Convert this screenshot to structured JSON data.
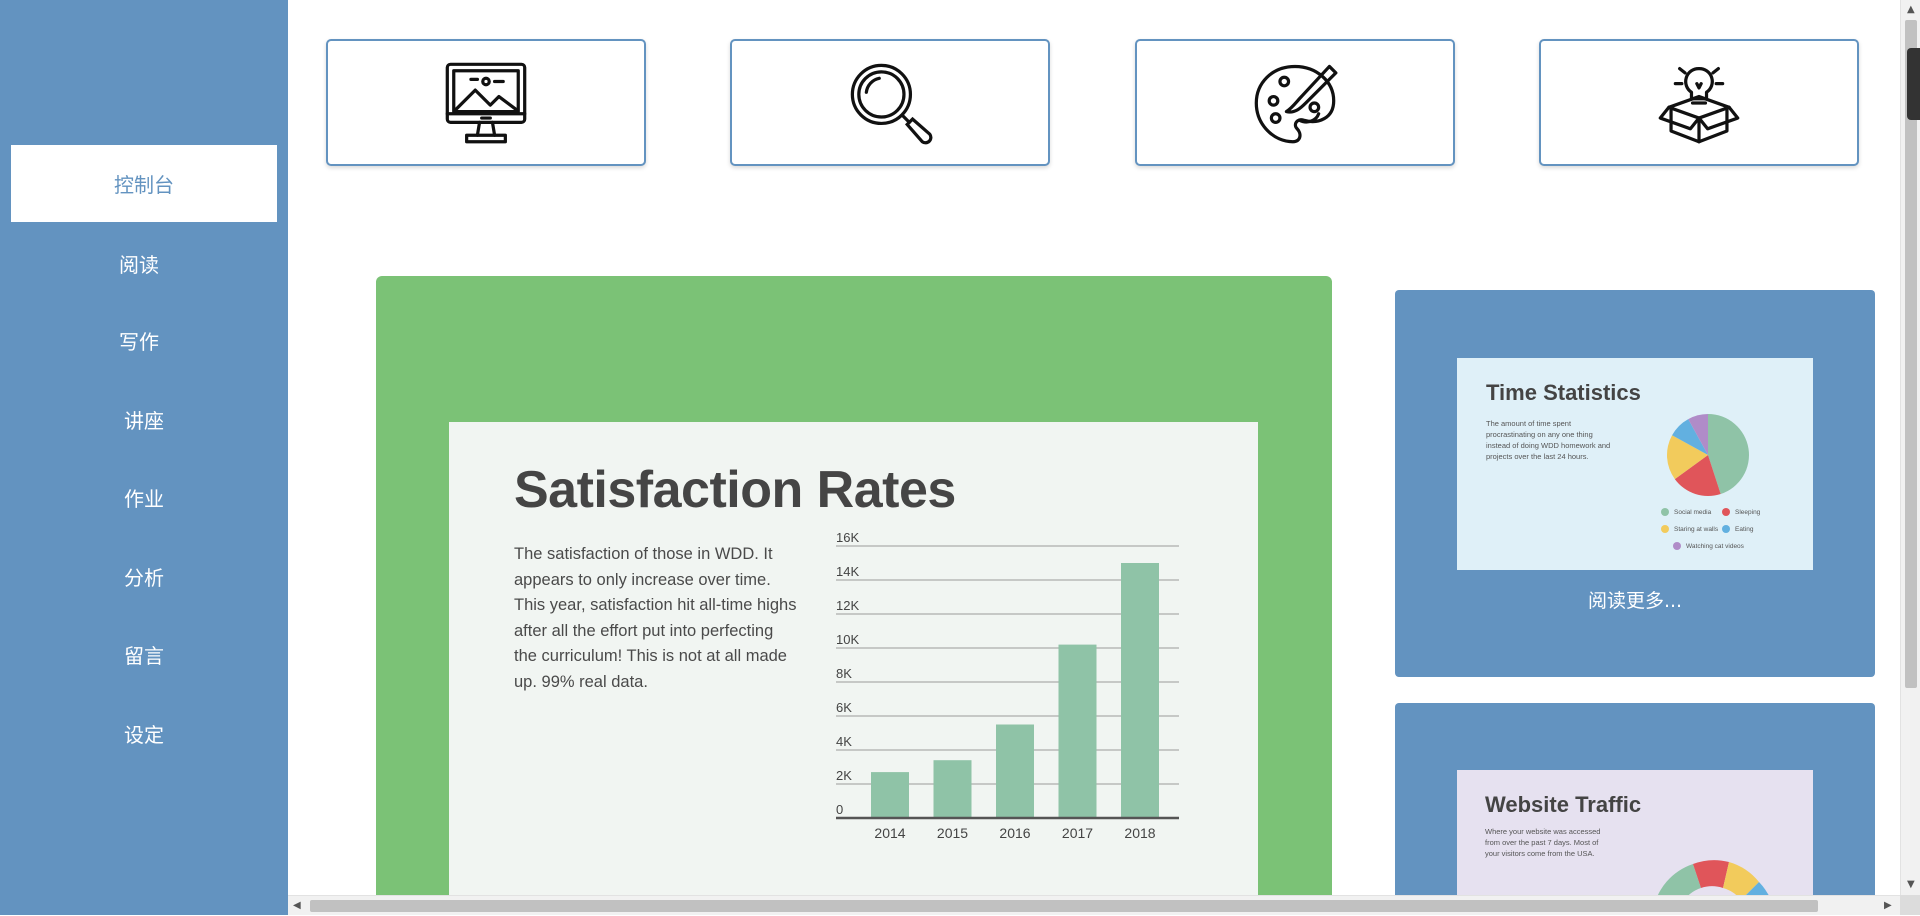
{
  "sidebar": {
    "items": [
      {
        "label": "控制台",
        "active": true
      },
      {
        "label": "阅读"
      },
      {
        "label": "写作"
      },
      {
        "label": "讲座"
      },
      {
        "label": "作业"
      },
      {
        "label": "分析"
      },
      {
        "label": "留言"
      },
      {
        "label": "设定"
      }
    ]
  },
  "quick_icons": [
    "monitor-picture-icon",
    "magnifier-icon",
    "palette-icon",
    "lightbulb-box-icon"
  ],
  "colors": {
    "sidebar": "#6393c0",
    "green_panel": "#7bc276",
    "bar": "#8fc3a7",
    "card": "#6393c0"
  },
  "satisfaction": {
    "title": "Satisfaction Rates",
    "description": "The satisfaction of those in WDD. It appears to only increase over time. This year, satisfaction hit all-time highs after all the effort put into perfecting the curriculum! This is not at all made up. 99% real data."
  },
  "chart_data": {
    "type": "bar",
    "categories": [
      "2014",
      "2015",
      "2016",
      "2017",
      "2018"
    ],
    "values": [
      2700,
      3400,
      5500,
      10200,
      15000
    ],
    "ylim": [
      0,
      16000
    ],
    "yticks": [
      "0",
      "2K",
      "4K",
      "6K",
      "8K",
      "10K",
      "12K",
      "14K",
      "16K"
    ],
    "grid": true
  },
  "time_stats": {
    "title": "Time Statistics",
    "description": "The amount of time spent procrastinating on any one thing instead of doing WDD homework and projects over the last 24 hours.",
    "legend": [
      "Social media",
      "Sleeping",
      "Staring at walls",
      "Eating",
      "Watching cat videos"
    ],
    "slices": [
      {
        "label": "Social media",
        "value": 45,
        "color": "#8fc3a7"
      },
      {
        "label": "Sleeping",
        "value": 20,
        "color": "#e0555a"
      },
      {
        "label": "Staring at walls",
        "value": 18,
        "color": "#f2cb5c"
      },
      {
        "label": "Eating",
        "value": 9,
        "color": "#62b0e0"
      },
      {
        "label": "Watching cat videos",
        "value": 8,
        "color": "#b08cc8"
      }
    ],
    "read_more": "阅读更多..."
  },
  "traffic": {
    "title": "Website Traffic",
    "description": "Where your website was accessed from over the past 7 days. Most of your visitors come from the USA."
  }
}
